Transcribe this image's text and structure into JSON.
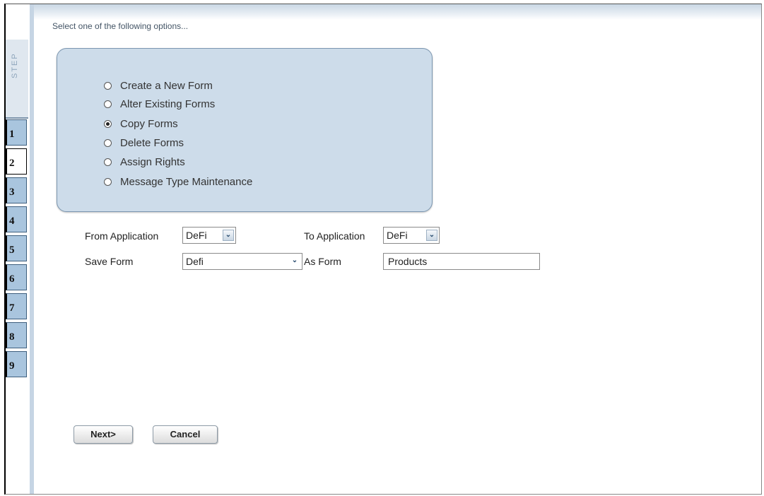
{
  "instruction": "Select one of the following options...",
  "step_panel": {
    "label": "STEP",
    "steps": [
      "1",
      "2",
      "3",
      "4",
      "5",
      "6",
      "7",
      "8",
      "9"
    ],
    "active_step": "2"
  },
  "options": [
    {
      "label": "Create a New Form",
      "checked": false
    },
    {
      "label": "Alter Existing Forms",
      "checked": false
    },
    {
      "label": "Copy Forms",
      "checked": true
    },
    {
      "label": "Delete Forms",
      "checked": false
    },
    {
      "label": "Assign Rights",
      "checked": false
    },
    {
      "label": "Message Type Maintenance",
      "checked": false
    }
  ],
  "form": {
    "from_application_label": "From Application",
    "from_application_value": "DeFi",
    "to_application_label": "To Application",
    "to_application_value": "DeFi",
    "save_form_label": "Save Form",
    "save_form_value": "Defi",
    "as_form_label": "As Form",
    "as_form_value": "Products"
  },
  "buttons": {
    "next": "Next>",
    "cancel": "Cancel"
  }
}
